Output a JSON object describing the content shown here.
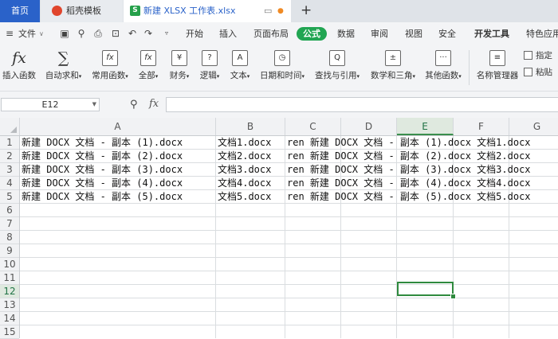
{
  "tabs": {
    "home": "首页",
    "template": "稻壳模板",
    "file": "新建 XLSX 工作表.xlsx",
    "file_icon": "S"
  },
  "menu": {
    "file": "文件",
    "items": [
      "开始",
      "插入",
      "页面布局",
      "公式",
      "数据",
      "审阅",
      "视图",
      "安全",
      "开发工具",
      "特色应用"
    ],
    "active": "公式",
    "active_color": "#21a552"
  },
  "ribbon": {
    "buttons": [
      {
        "label": "插入函数",
        "icon": "fx-icon",
        "glyph": "fx"
      },
      {
        "label": "自动求和",
        "icon": "sum-icon",
        "glyph": "∑"
      },
      {
        "label": "常用函数",
        "icon": "common-func-icon",
        "glyph": "fx"
      },
      {
        "label": "全部",
        "icon": "all-func-icon",
        "glyph": "fx"
      },
      {
        "label": "财务",
        "icon": "finance-icon",
        "glyph": "¥"
      },
      {
        "label": "逻辑",
        "icon": "logic-icon",
        "glyph": "?"
      },
      {
        "label": "文本",
        "icon": "text-icon",
        "glyph": "A"
      },
      {
        "label": "日期和时间",
        "icon": "clock-icon",
        "glyph": "◷"
      },
      {
        "label": "查找与引用",
        "icon": "lookup-icon",
        "glyph": "Q"
      },
      {
        "label": "数学和三角",
        "icon": "math-icon",
        "glyph": "±"
      },
      {
        "label": "其他函数",
        "icon": "more-func-icon",
        "glyph": "···"
      },
      {
        "label": "名称管理器",
        "icon": "name-manager-icon",
        "glyph": "≡"
      }
    ],
    "small": [
      "指定",
      "粘贴"
    ]
  },
  "formula_bar": {
    "name_box": "E12",
    "fx": "fx",
    "value": ""
  },
  "grid": {
    "columns": [
      "A",
      "B",
      "C",
      "D",
      "E",
      "F",
      "G"
    ],
    "selected_column": "E",
    "rows": [
      "1",
      "2",
      "3",
      "4",
      "5",
      "6",
      "7",
      "8",
      "9",
      "10",
      "11",
      "12",
      "13",
      "14",
      "15"
    ],
    "selected_row": "12",
    "selection_color": "#2f8a3e",
    "cells": [
      [
        "新建 DOCX 文档 - 副本 (1).docx",
        "文档1.docx",
        "ren 新建 DOCX 文档 - 副本 (1).docx 文档1.docx"
      ],
      [
        "新建 DOCX 文档 - 副本 (2).docx",
        "文档2.docx",
        "ren 新建 DOCX 文档 - 副本 (2).docx 文档2.docx"
      ],
      [
        "新建 DOCX 文档 - 副本 (3).docx",
        "文档3.docx",
        "ren 新建 DOCX 文档 - 副本 (3).docx 文档3.docx"
      ],
      [
        "新建 DOCX 文档 - 副本 (4).docx",
        "文档4.docx",
        "ren 新建 DOCX 文档 - 副本 (4).docx 文档4.docx"
      ],
      [
        "新建 DOCX 文档 - 副本 (5).docx",
        "文档5.docx",
        "ren 新建 DOCX 文档 - 副本 (5).docx 文档5.docx"
      ]
    ]
  }
}
